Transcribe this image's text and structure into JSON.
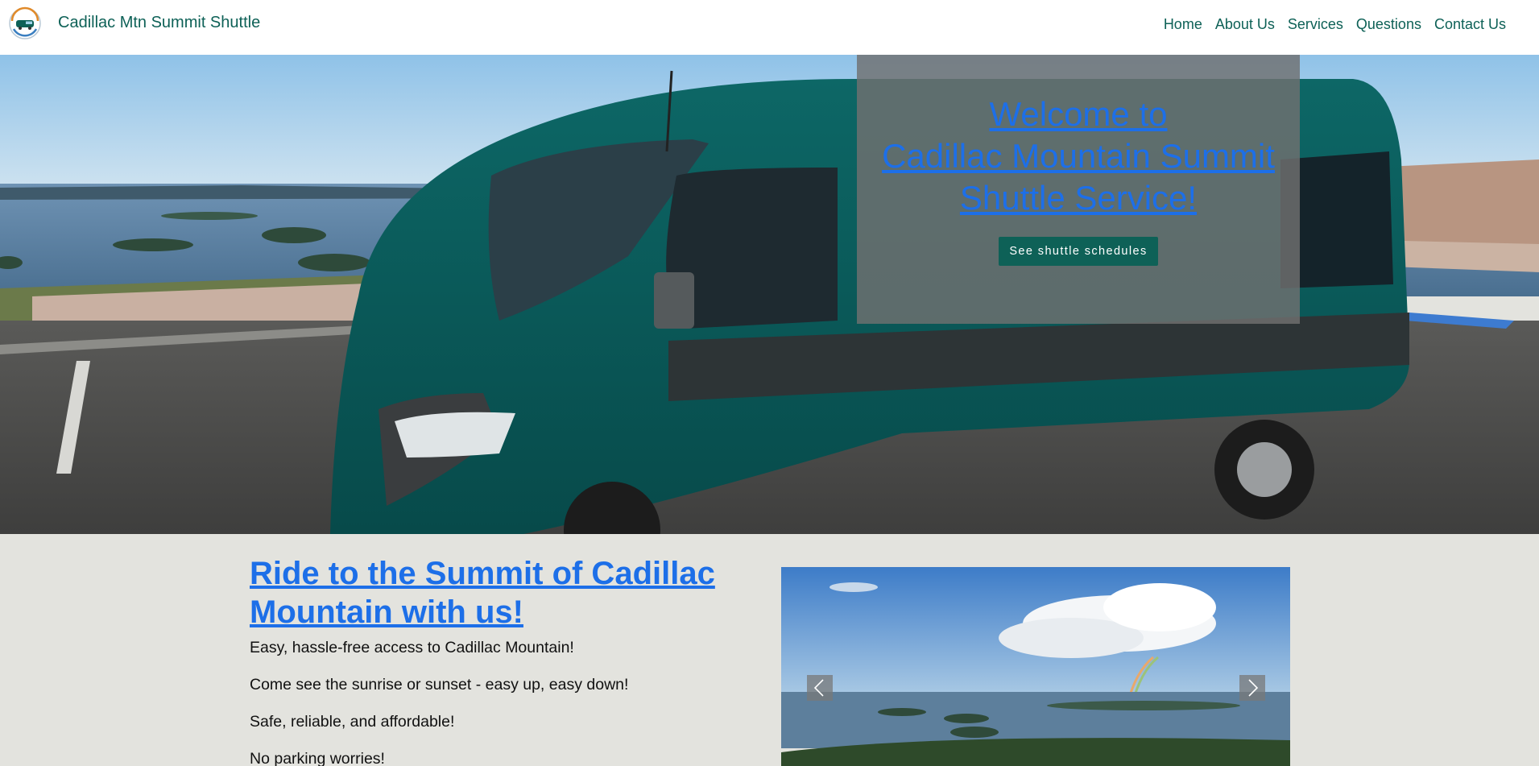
{
  "header": {
    "site_title": "Cadillac Mtn Summit Shuttle",
    "nav": [
      "Home",
      "About Us",
      "Services",
      "Questions",
      "Contact Us"
    ]
  },
  "hero": {
    "welcome_lines": [
      "Welcome to",
      "Cadillac Mountain Summit",
      "Shuttle Service!"
    ],
    "cta_label": "See shuttle schedules"
  },
  "main": {
    "heading": "Ride to the Summit of Cadillac Mountain with us!",
    "features": [
      "Easy, hassle-free access to Cadillac Mountain!",
      "Come see the sunrise or sunset - easy up, easy down!",
      "Safe, reliable, and affordable!",
      "No parking worries!"
    ]
  },
  "carousel": {
    "prev_icon": "chevron-left-icon",
    "next_icon": "chevron-right-icon"
  },
  "colors": {
    "brand": "#0e6157",
    "link": "#1d6fe8",
    "page_background": "#e3e3de",
    "overlay": "#707070"
  }
}
